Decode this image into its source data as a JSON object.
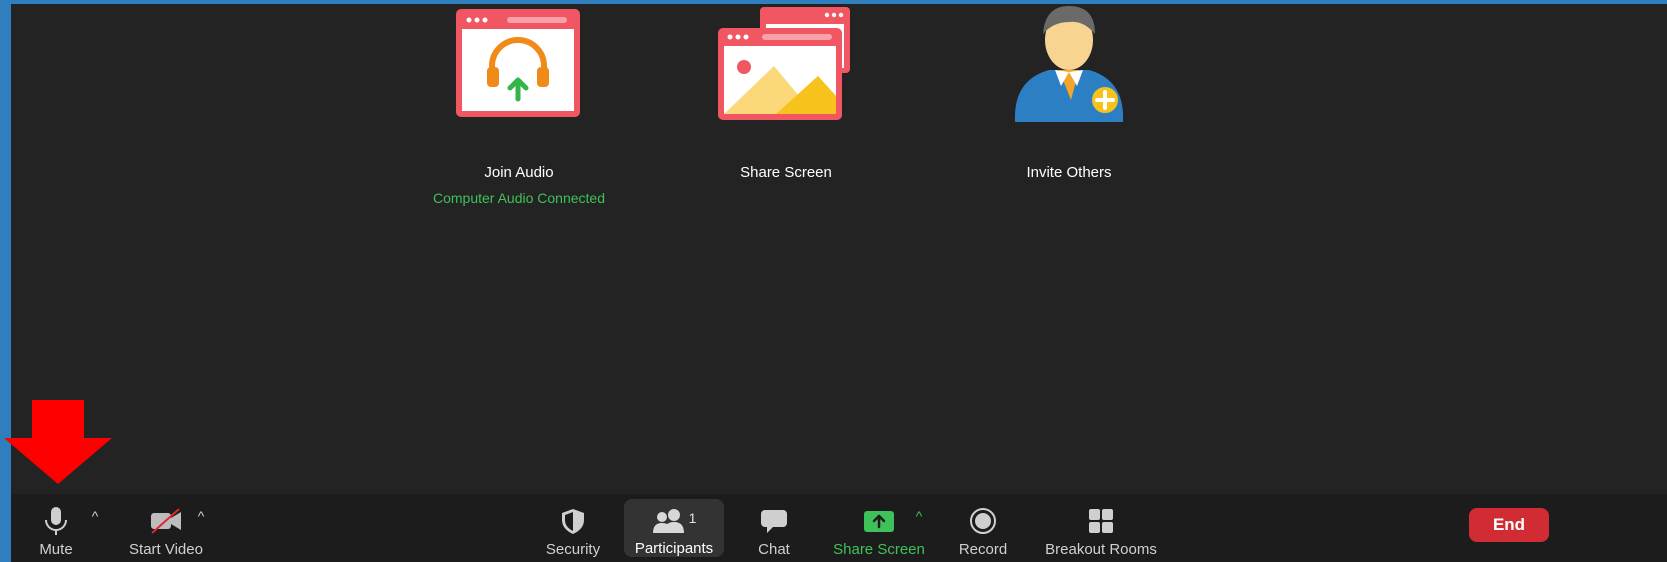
{
  "actions": {
    "join_audio": {
      "label": "Join Audio",
      "status": "Computer Audio Connected",
      "icon": "headphones-upload-icon"
    },
    "share_screen": {
      "label": "Share Screen",
      "icon": "share-screen-windows-icon"
    },
    "invite_others": {
      "label": "Invite Others",
      "icon": "add-person-icon"
    }
  },
  "toolbar": {
    "mute": {
      "label": "Mute",
      "icon": "microphone-icon"
    },
    "start_video": {
      "label": "Start Video",
      "icon": "video-off-icon"
    },
    "security": {
      "label": "Security",
      "icon": "shield-icon"
    },
    "participants": {
      "label": "Participants",
      "count": "1",
      "icon": "participants-icon"
    },
    "chat": {
      "label": "Chat",
      "icon": "chat-bubble-icon"
    },
    "share_screen": {
      "label": "Share Screen",
      "icon": "share-arrow-icon"
    },
    "record": {
      "label": "Record",
      "icon": "record-icon"
    },
    "breakout_rooms": {
      "label": "Breakout Rooms",
      "icon": "grid-icon"
    },
    "end": {
      "label": "End"
    },
    "caret": "^"
  },
  "colors": {
    "background": "#232323",
    "toolbar": "#1c1c1c",
    "green": "#3fc15a",
    "end_red": "#d12c33",
    "annotation_red": "#ff0000"
  }
}
